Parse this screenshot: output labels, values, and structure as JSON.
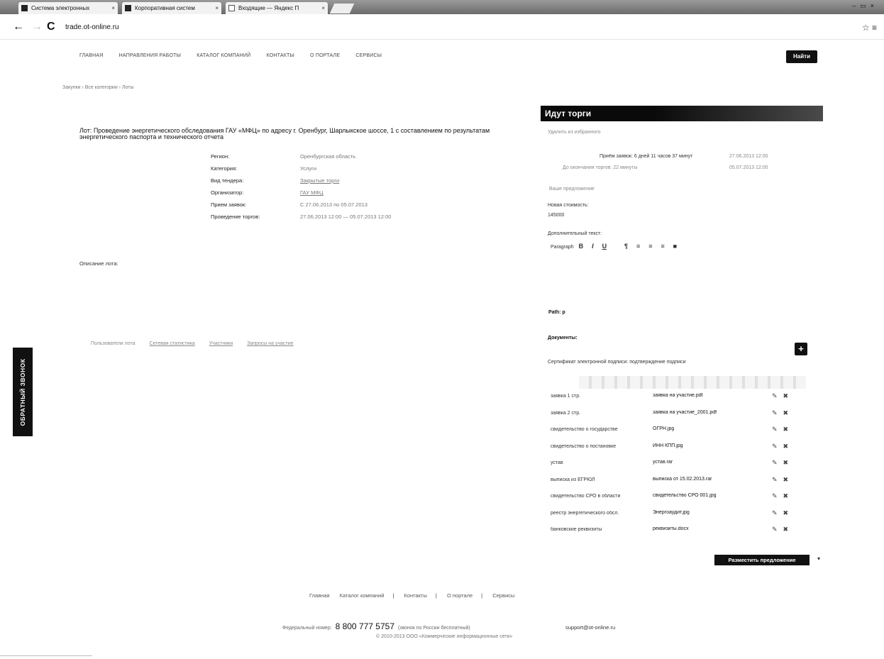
{
  "browser": {
    "tabs": [
      {
        "label": "Система электронных"
      },
      {
        "label": "Корпоративная систем"
      },
      {
        "label": "Входящие — Яндекс П"
      }
    ],
    "url_host": "trade.ot-online.ru"
  },
  "nav": {
    "items": [
      "Главная",
      "Направления работы",
      "Каталог компаний",
      "Контакты",
      "О портале",
      "Сервисы"
    ],
    "find_label": "Найти"
  },
  "breadcrumb": "Закупки › Все категории › Лоты",
  "lot": {
    "title": "Лот: Проведение энергетического обследования ГАУ «МФЦ» по адресу г. Оренбург, Шарлыкское шоссе, 1 с составлением по результатам энергетического паспорта и технического отчета",
    "props": [
      {
        "k": "Регион:",
        "v": "Оренбургская область"
      },
      {
        "k": "Категория:",
        "v": "Услуги"
      },
      {
        "k": "Вид тендера:",
        "v": "Закрытые торги"
      },
      {
        "k": "Организатор:",
        "v": "ГАУ МФЦ"
      },
      {
        "k": "Прием заявок:",
        "v": "С 27.06.2013 по 05.07.2013"
      },
      {
        "k": "Проведение торгов:",
        "v": "27.06.2013 12:00 — 05.07.2013 12:00"
      }
    ],
    "description_label": "Описание лота:",
    "links": [
      "Пользователи лота",
      "Сетевая статистика",
      "Участники",
      "Запросы на участие"
    ]
  },
  "callback_label": "ОБРАТНЫЙ ЗВОНОК",
  "trade": {
    "header": "Идут торги",
    "remove_favorite": "Удалить из избранного",
    "end_accept": "Приём заявок: 6 дней 11 часов 37 минут",
    "end_accept_date": "27.06.2013 12:00",
    "end_trade": "До окончания торгов: 22 минуты",
    "end_trade_date": "05.07.2013 12:00",
    "your_offer": "Ваше предложение",
    "new_price_label": "Новая стоимость:",
    "new_price_value": "145000",
    "extra_text_label": "Дополнительный текст:",
    "editor_paragraph": "Paragraph",
    "path_label": "Path: p",
    "documents_label": "Документы:",
    "documents_hint": "Сертификат электронной подписи: подтверждение подписи",
    "submit_label": "Разместить предложение"
  },
  "documents": [
    {
      "name": "заявка 1 стр.",
      "file": "заявка на участие.pdf"
    },
    {
      "name": "заявка 2 стр.",
      "file": "заявка на участие_2001.pdf"
    },
    {
      "name": "свидетельство о государстве",
      "file": "ОГРН.jpg"
    },
    {
      "name": "свидетельство о постановке",
      "file": "ИНН КПП.jpg"
    },
    {
      "name": "устав",
      "file": "устав.rar"
    },
    {
      "name": "выписка из ЕГРЮЛ",
      "file": "выписка от 15.02.2013.rar"
    },
    {
      "name": "свидетельство СРО в области",
      "file": "свидетельство СРО 001.jpg"
    },
    {
      "name": "реестр энергетического обсл.",
      "file": "Энергоаудит.jpg"
    },
    {
      "name": "банковские реквизиты",
      "file": "реквизиты.docx"
    }
  ],
  "footer": {
    "links": [
      "Главная",
      "Каталог компаний",
      "Контакты",
      "О портале",
      "Сервисы"
    ],
    "phone_prefix": "Федеральный номер:",
    "phone": "8 800 777 5757",
    "phone_suffix": "(звонок по России бесплатный)",
    "email": "support@ot-online.ru",
    "copyright": "© 2010-2013 ООО «Коммерческие информационные сети»"
  },
  "colors": {
    "accent": "#111111",
    "panel_header": "#0a0a0a"
  }
}
